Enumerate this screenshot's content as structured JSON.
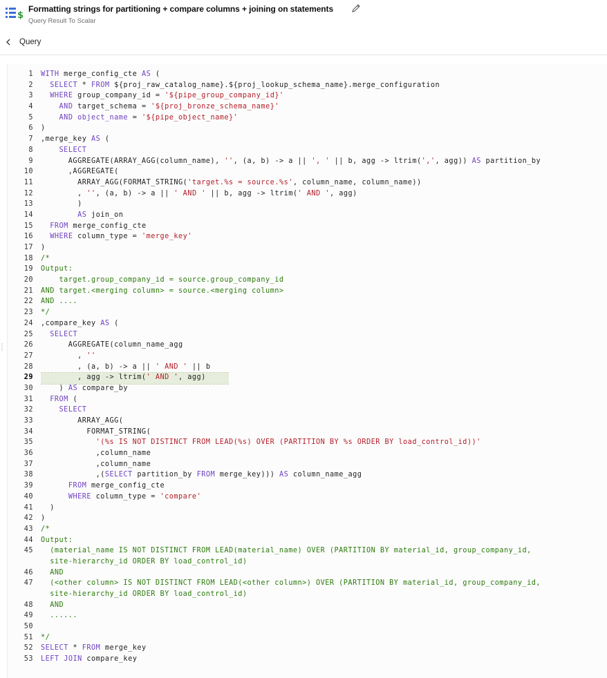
{
  "header": {
    "title": "Formatting strings for partitioning + compare columns + joining on statements",
    "subtitle": "Query Result To Scalar"
  },
  "nav": {
    "back_label": "Query"
  },
  "icons": {
    "app": "query-to-scalar-icon",
    "edit": "pencil-icon",
    "back": "chevron-left-icon"
  },
  "colors": {
    "keyword": "#6f42c1",
    "string": "#b31d28",
    "comment": "#2b7a0b",
    "highlight": "#e6eddc"
  },
  "editor": {
    "current_line": "29",
    "lines": [
      {
        "n": "1",
        "t": "WITH merge_config_cte AS ("
      },
      {
        "n": "2",
        "t": "  SELECT * FROM ${proj_raw_catalog_name}.${proj_lookup_schema_name}.merge_configuration"
      },
      {
        "n": "3",
        "t": "  WHERE group_company_id = '${pipe_group_company_id}'"
      },
      {
        "n": "4",
        "t": "    AND target_schema = '${proj_bronze_schema_name}'"
      },
      {
        "n": "5",
        "t": "    AND object_name = '${pipe_object_name}'"
      },
      {
        "n": "6",
        "t": ")"
      },
      {
        "n": "7",
        "t": ",merge_key AS ("
      },
      {
        "n": "8",
        "t": "    SELECT"
      },
      {
        "n": "9",
        "t": "      AGGREGATE(ARRAY_AGG(column_name), '', (a, b) -> a || ', ' || b, agg -> ltrim(',', agg)) AS partition_by"
      },
      {
        "n": "10",
        "t": "      ,AGGREGATE("
      },
      {
        "n": "11",
        "t": "        ARRAY_AGG(FORMAT_STRING('target.%s = source.%s', column_name, column_name))"
      },
      {
        "n": "12",
        "t": "        , '', (a, b) -> a || ' AND ' || b, agg -> ltrim(' AND ', agg)"
      },
      {
        "n": "13",
        "t": "        )"
      },
      {
        "n": "14",
        "t": "        AS join_on"
      },
      {
        "n": "15",
        "t": "  FROM merge_config_cte"
      },
      {
        "n": "16",
        "t": "  WHERE column_type = 'merge_key'"
      },
      {
        "n": "17",
        "t": ")"
      },
      {
        "n": "18",
        "t": "/*"
      },
      {
        "n": "19",
        "t": "Output:"
      },
      {
        "n": "20",
        "t": "    target.group_company_id = source.group_company_id"
      },
      {
        "n": "21",
        "t": "AND target.<merging column> = source.<merging column>"
      },
      {
        "n": "22",
        "t": "AND ...."
      },
      {
        "n": "23",
        "t": "*/"
      },
      {
        "n": "24",
        "t": ",compare_key AS ("
      },
      {
        "n": "25",
        "t": "  SELECT"
      },
      {
        "n": "26",
        "t": "      AGGREGATE(column_name_agg"
      },
      {
        "n": "27",
        "t": "        , ''"
      },
      {
        "n": "28",
        "t": "        , (a, b) -> a || ' AND ' || b"
      },
      {
        "n": "29",
        "t": "        , agg -> ltrim(' AND ', agg)"
      },
      {
        "n": "30",
        "t": "    ) AS compare_by"
      },
      {
        "n": "31",
        "t": "  FROM ("
      },
      {
        "n": "32",
        "t": "    SELECT"
      },
      {
        "n": "33",
        "t": "        ARRAY_AGG("
      },
      {
        "n": "34",
        "t": "          FORMAT_STRING("
      },
      {
        "n": "35",
        "t": "            '(%s IS NOT DISTINCT FROM LEAD(%s) OVER (PARTITION BY %s ORDER BY load_control_id))'"
      },
      {
        "n": "36",
        "t": "            ,column_name"
      },
      {
        "n": "37",
        "t": "            ,column_name"
      },
      {
        "n": "38",
        "t": "            ,(SELECT partition_by FROM merge_key))) AS column_name_agg"
      },
      {
        "n": "39",
        "t": "      FROM merge_config_cte"
      },
      {
        "n": "40",
        "t": "      WHERE column_type = 'compare'"
      },
      {
        "n": "41",
        "t": "  )"
      },
      {
        "n": "42",
        "t": ")"
      },
      {
        "n": "43",
        "t": "/*"
      },
      {
        "n": "44",
        "t": "Output:"
      },
      {
        "n": "45",
        "t": "  (material_name IS NOT DISTINCT FROM LEAD(material_name) OVER (PARTITION BY material_id, group_company_id,"
      },
      {
        "n": "",
        "t": "  site-hierarchy_id ORDER BY load_control_id)"
      },
      {
        "n": "46",
        "t": "  AND"
      },
      {
        "n": "47",
        "t": "  (<other column> IS NOT DISTINCT FROM LEAD(<other column>) OVER (PARTITION BY material_id, group_company_id,"
      },
      {
        "n": "",
        "t": "  site-hierarchy_id ORDER BY load_control_id)"
      },
      {
        "n": "48",
        "t": "  AND"
      },
      {
        "n": "49",
        "t": "  ......"
      },
      {
        "n": "50",
        "t": ""
      },
      {
        "n": "51",
        "t": "*/"
      },
      {
        "n": "52",
        "t": "SELECT * FROM merge_key"
      },
      {
        "n": "53",
        "t": "LEFT JOIN compare_key"
      }
    ]
  }
}
